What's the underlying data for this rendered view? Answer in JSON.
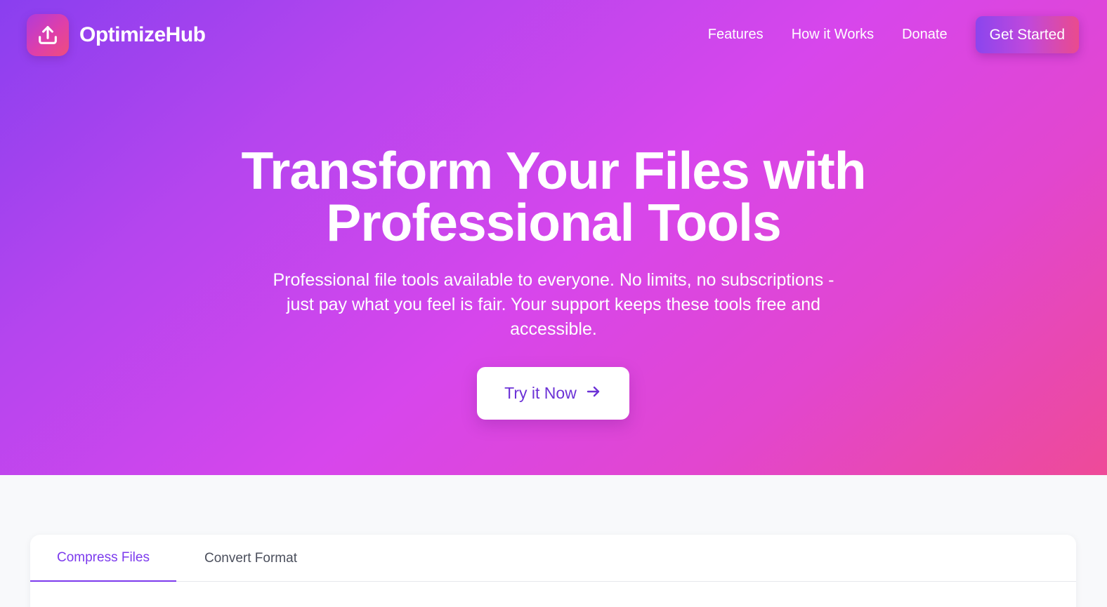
{
  "brand": {
    "name": "OptimizeHub",
    "icon": "upload-icon"
  },
  "nav": {
    "links": [
      "Features",
      "How it Works",
      "Donate"
    ],
    "cta_label": "Get Started"
  },
  "hero": {
    "title_line1": "Transform Your Files with",
    "title_line2": "Professional Tools",
    "subtitle": "Professional file tools available to everyone. No limits, no subscriptions - just pay what you feel is fair. Your support keeps these tools free and accessible.",
    "cta_label": "Try it Now",
    "cta_icon": "arrow-right-icon"
  },
  "tools": {
    "tabs": [
      {
        "label": "Compress Files",
        "active": true
      },
      {
        "label": "Convert Format",
        "active": false
      }
    ]
  },
  "colors": {
    "accent": "#7c3aed",
    "gradient_start": "#8a3fef",
    "gradient_mid": "#d746ec",
    "gradient_end": "#ee4a98",
    "page_bg": "#f8f9fb"
  }
}
